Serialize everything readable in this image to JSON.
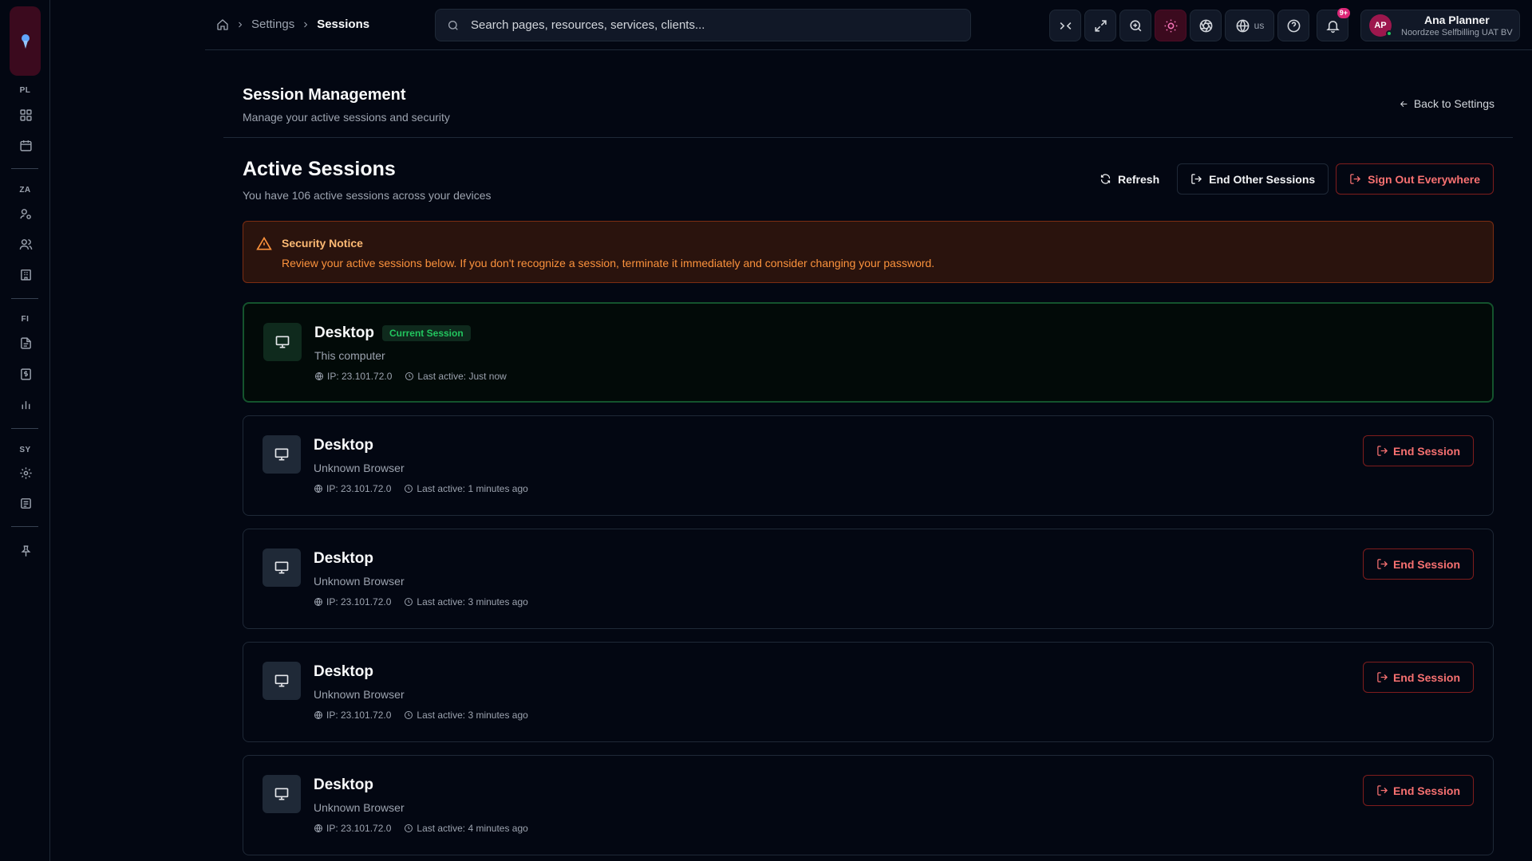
{
  "breadcrumb": {
    "home_icon": "home-icon",
    "items": [
      "Settings",
      "Sessions"
    ]
  },
  "search": {
    "placeholder": "Search pages, resources, services, clients..."
  },
  "toolbar": {
    "language": "us",
    "notification_badge": "9+"
  },
  "user": {
    "initials": "AP",
    "name": "Ana Planner",
    "org": "Noordzee Selfbilling UAT BV"
  },
  "sidebar": {
    "sections": [
      "PL",
      "ZA",
      "FI",
      "SY"
    ]
  },
  "page": {
    "title": "Session Management",
    "subtitle": "Manage your active sessions and security",
    "back_label": "Back to Settings"
  },
  "active": {
    "title": "Active Sessions",
    "subtitle": "You have 106 active sessions across your devices",
    "refresh_label": "Refresh",
    "end_other_label": "End Other Sessions",
    "sign_out_label": "Sign Out Everywhere"
  },
  "notice": {
    "title": "Security Notice",
    "text": "Review your active sessions below. If you don't recognize a session, terminate it immediately and consider changing your password."
  },
  "sessions": [
    {
      "device": "Desktop",
      "badge": "Current Session",
      "browser": "This computer",
      "ip": "IP: 23.101.72.0",
      "last_active": "Last active: Just now"
    },
    {
      "device": "Desktop",
      "browser": "Unknown Browser",
      "ip": "IP: 23.101.72.0",
      "last_active": "Last active: 1 minutes ago",
      "action": "End Session"
    },
    {
      "device": "Desktop",
      "browser": "Unknown Browser",
      "ip": "IP: 23.101.72.0",
      "last_active": "Last active: 3 minutes ago",
      "action": "End Session"
    },
    {
      "device": "Desktop",
      "browser": "Unknown Browser",
      "ip": "IP: 23.101.72.0",
      "last_active": "Last active: 3 minutes ago",
      "action": "End Session"
    },
    {
      "device": "Desktop",
      "browser": "Unknown Browser",
      "ip": "IP: 23.101.72.0",
      "last_active": "Last active: 4 minutes ago",
      "action": "End Session"
    }
  ],
  "colors": {
    "accent": "#db2777",
    "danger": "#f87171",
    "success": "#22c55e",
    "warning": "#fb923c"
  }
}
